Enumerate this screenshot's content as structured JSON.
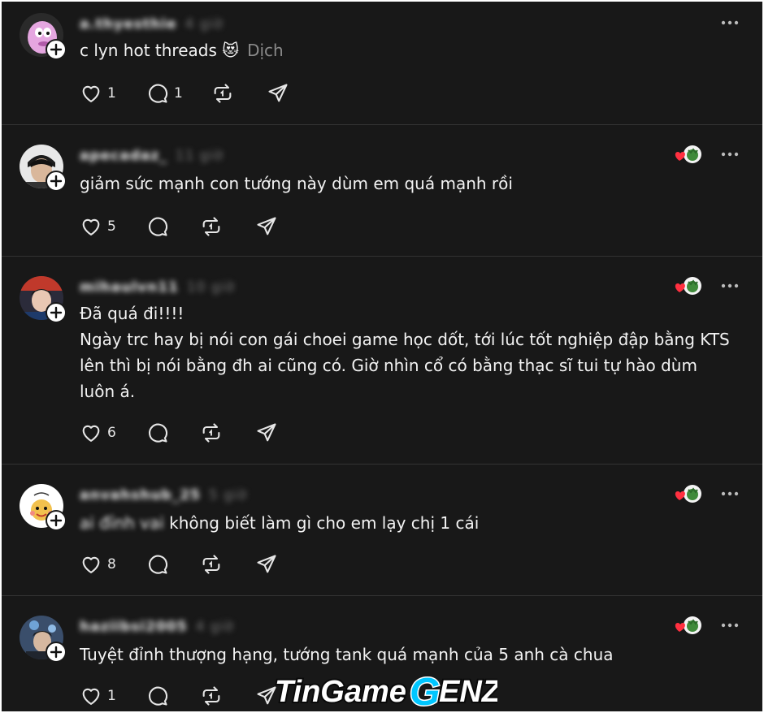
{
  "posts": [
    {
      "username": "a.thyesthie",
      "time": "4 giờ",
      "text": "c lyn hot threads 😻",
      "translate_label": "Dịch",
      "likes": "1",
      "replies": "1",
      "has_reaction": false
    },
    {
      "username": "apecadaz_",
      "time": "11 giờ",
      "text": "giảm sức mạnh con tướng này dùm em quá mạnh rồi",
      "likes": "5",
      "replies": "",
      "has_reaction": true
    },
    {
      "username": "mihaulvn11",
      "time": "10 giờ",
      "text": "Đã quá đi!!!!\nNgày trc hay bị nói con gái choei game học dốt, tới lúc tốt nghiệp đập bằng KTS\nlên thì bị nói bằng đh ai cũng có. Giờ nhìn cổ có bằng thạc sĩ tui tự hào dùm\nluôn á.",
      "likes": "6",
      "replies": "",
      "has_reaction": true
    },
    {
      "username": "anvahshub_25",
      "time": "5 giờ",
      "text_prefix": "ai đỉnh vai",
      "text": "không biết làm gì cho em lạy chị 1 cái",
      "likes": "8",
      "replies": "",
      "has_reaction": true
    },
    {
      "username": "haziibsi2005",
      "time": "4 giờ",
      "text": "Tuyệt đỉnh thượng hạng, tướng tank quá mạnh của 5 anh cà chua",
      "likes": "1",
      "replies": "",
      "has_reaction": true
    }
  ],
  "icons": {
    "like": "heart-icon",
    "reply": "comment-icon",
    "repost": "repost-icon",
    "share": "send-icon",
    "more": "more-icon",
    "follow": "plus-icon"
  },
  "watermark": {
    "part1": "TinGame",
    "part2": "G",
    "part3": "ENZ"
  },
  "colors": {
    "background": "#181818",
    "text": "#f3f3f3",
    "muted": "#777777",
    "reaction_heart": "#ff3040",
    "watermark_accent": "#00c6ff"
  }
}
